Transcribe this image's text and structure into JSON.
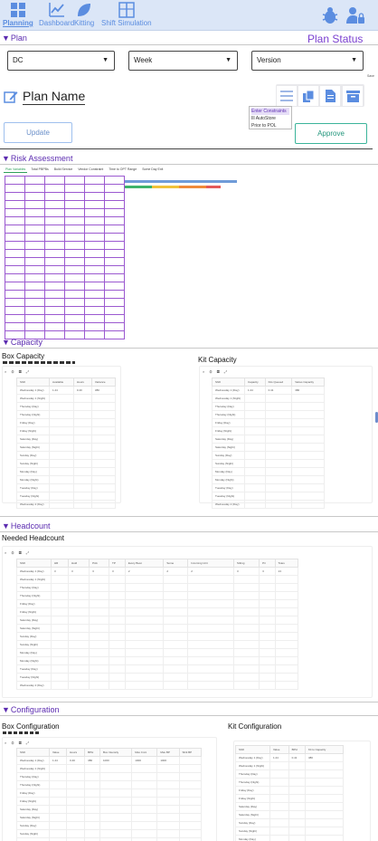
{
  "nav": {
    "planning": "Planning",
    "dashboard": "Dashboard",
    "kitting": "Kitting",
    "shift_simulation": "Shift Simulation"
  },
  "plan": {
    "section_label": "Plan",
    "status_label": "Plan Status",
    "dropdowns": {
      "dc": "DC",
      "week": "Week",
      "version": "Version"
    },
    "corner_text": "Save",
    "plan_name": "Plan Name",
    "update_label": "Update",
    "approve_label": "Approve",
    "menu_items": [
      "Enter Constraints",
      "Ill AutoStore",
      "Prior to POL"
    ]
  },
  "risk": {
    "section_label": "Risk Assessment",
    "tabs": [
      "Plan Variables",
      "Total PBPBs",
      "Build Service",
      "Vendor Constraint",
      "Time to OPT Range",
      "Some Day Exit"
    ]
  },
  "capacity": {
    "section_label": "Capacity",
    "box_title": "Box Capacity",
    "kit_title": "Kit Capacity",
    "box_columns": [
      "Shift",
      "Available",
      "Hours",
      "Variance"
    ],
    "kit_columns": [
      "Shift",
      "Capacity",
      "Kits Queued",
      "Varies Capacity"
    ],
    "box_first_values": [
      "1.24",
      "0.40",
      "380"
    ],
    "kit_first_values": [
      "1.44",
      "0.41",
      "380"
    ]
  },
  "headcount": {
    "section_label": "Headcount",
    "needed_title": "Needed Headcount",
    "columns": [
      "Shift",
      "HR",
      "Hold",
      "Pick",
      "TP",
      "Every Beat",
      "Some",
      "Incoming Unit",
      "Sitting",
      "Pri",
      "Totes"
    ],
    "first_values": [
      "3",
      "3",
      "3",
      "3",
      "2",
      "2",
      "2",
      "3",
      "3",
      "13"
    ]
  },
  "configuration": {
    "section_label": "Configuration",
    "box_title": "Box Configuration",
    "kit_title": "Kit Configuration",
    "box_columns": [
      "Shift",
      "Value",
      "Hours",
      "BPH",
      "Box Intensity",
      "Max Cnnt",
      "Max BP",
      "Shiit BP"
    ],
    "kit_columns": [
      "Shift",
      "Value",
      "BPH",
      "Kit to Capacity"
    ],
    "box_first_values": [
      "1.24",
      "0.40",
      "380",
      "1000",
      "1000",
      "1000"
    ],
    "kit_first_values": [
      "1.24",
      "0.41",
      "380"
    ]
  },
  "shift_rows": [
    "Wednesday 1 (Day)",
    "Wednesday 1 (Night)",
    "Thursday (Day)",
    "Thursday (Night)",
    "Friday (Day)",
    "Friday (Night)",
    "Saturday (Day)",
    "Saturday (Night)",
    "Sunday (Day)",
    "Sunday (Night)",
    "Monday (Day)",
    "Monday (Night)",
    "Tuesday (Day)",
    "Tuesday (Night)",
    "Wednesday 2 (Day)",
    "Wednesday 2 (Night)"
  ],
  "colors": {
    "accent": "#5b2bb0",
    "nav_blue": "#5b8de0",
    "teal": "#23967c",
    "bar_blue": "#6f9bd8",
    "bar_green": "#3eb36b",
    "bar_yellow": "#f0c23a",
    "bar_red": "#e45a5a"
  }
}
